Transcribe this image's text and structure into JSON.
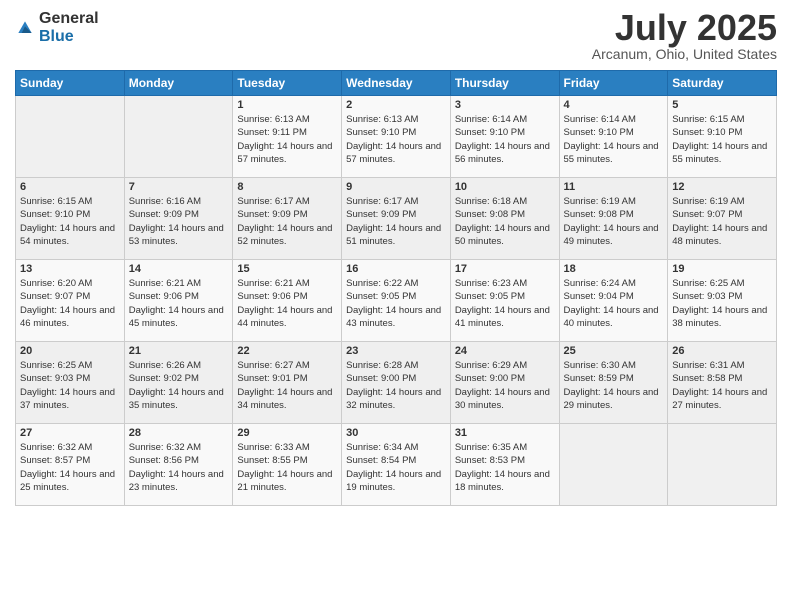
{
  "logo": {
    "general": "General",
    "blue": "Blue"
  },
  "title": "July 2025",
  "subtitle": "Arcanum, Ohio, United States",
  "weekdays": [
    "Sunday",
    "Monday",
    "Tuesday",
    "Wednesday",
    "Thursday",
    "Friday",
    "Saturday"
  ],
  "weeks": [
    [
      {
        "day": "",
        "info": ""
      },
      {
        "day": "",
        "info": ""
      },
      {
        "day": "1",
        "info": "Sunrise: 6:13 AM\nSunset: 9:11 PM\nDaylight: 14 hours and 57 minutes."
      },
      {
        "day": "2",
        "info": "Sunrise: 6:13 AM\nSunset: 9:10 PM\nDaylight: 14 hours and 57 minutes."
      },
      {
        "day": "3",
        "info": "Sunrise: 6:14 AM\nSunset: 9:10 PM\nDaylight: 14 hours and 56 minutes."
      },
      {
        "day": "4",
        "info": "Sunrise: 6:14 AM\nSunset: 9:10 PM\nDaylight: 14 hours and 55 minutes."
      },
      {
        "day": "5",
        "info": "Sunrise: 6:15 AM\nSunset: 9:10 PM\nDaylight: 14 hours and 55 minutes."
      }
    ],
    [
      {
        "day": "6",
        "info": "Sunrise: 6:15 AM\nSunset: 9:10 PM\nDaylight: 14 hours and 54 minutes."
      },
      {
        "day": "7",
        "info": "Sunrise: 6:16 AM\nSunset: 9:09 PM\nDaylight: 14 hours and 53 minutes."
      },
      {
        "day": "8",
        "info": "Sunrise: 6:17 AM\nSunset: 9:09 PM\nDaylight: 14 hours and 52 minutes."
      },
      {
        "day": "9",
        "info": "Sunrise: 6:17 AM\nSunset: 9:09 PM\nDaylight: 14 hours and 51 minutes."
      },
      {
        "day": "10",
        "info": "Sunrise: 6:18 AM\nSunset: 9:08 PM\nDaylight: 14 hours and 50 minutes."
      },
      {
        "day": "11",
        "info": "Sunrise: 6:19 AM\nSunset: 9:08 PM\nDaylight: 14 hours and 49 minutes."
      },
      {
        "day": "12",
        "info": "Sunrise: 6:19 AM\nSunset: 9:07 PM\nDaylight: 14 hours and 48 minutes."
      }
    ],
    [
      {
        "day": "13",
        "info": "Sunrise: 6:20 AM\nSunset: 9:07 PM\nDaylight: 14 hours and 46 minutes."
      },
      {
        "day": "14",
        "info": "Sunrise: 6:21 AM\nSunset: 9:06 PM\nDaylight: 14 hours and 45 minutes."
      },
      {
        "day": "15",
        "info": "Sunrise: 6:21 AM\nSunset: 9:06 PM\nDaylight: 14 hours and 44 minutes."
      },
      {
        "day": "16",
        "info": "Sunrise: 6:22 AM\nSunset: 9:05 PM\nDaylight: 14 hours and 43 minutes."
      },
      {
        "day": "17",
        "info": "Sunrise: 6:23 AM\nSunset: 9:05 PM\nDaylight: 14 hours and 41 minutes."
      },
      {
        "day": "18",
        "info": "Sunrise: 6:24 AM\nSunset: 9:04 PM\nDaylight: 14 hours and 40 minutes."
      },
      {
        "day": "19",
        "info": "Sunrise: 6:25 AM\nSunset: 9:03 PM\nDaylight: 14 hours and 38 minutes."
      }
    ],
    [
      {
        "day": "20",
        "info": "Sunrise: 6:25 AM\nSunset: 9:03 PM\nDaylight: 14 hours and 37 minutes."
      },
      {
        "day": "21",
        "info": "Sunrise: 6:26 AM\nSunset: 9:02 PM\nDaylight: 14 hours and 35 minutes."
      },
      {
        "day": "22",
        "info": "Sunrise: 6:27 AM\nSunset: 9:01 PM\nDaylight: 14 hours and 34 minutes."
      },
      {
        "day": "23",
        "info": "Sunrise: 6:28 AM\nSunset: 9:00 PM\nDaylight: 14 hours and 32 minutes."
      },
      {
        "day": "24",
        "info": "Sunrise: 6:29 AM\nSunset: 9:00 PM\nDaylight: 14 hours and 30 minutes."
      },
      {
        "day": "25",
        "info": "Sunrise: 6:30 AM\nSunset: 8:59 PM\nDaylight: 14 hours and 29 minutes."
      },
      {
        "day": "26",
        "info": "Sunrise: 6:31 AM\nSunset: 8:58 PM\nDaylight: 14 hours and 27 minutes."
      }
    ],
    [
      {
        "day": "27",
        "info": "Sunrise: 6:32 AM\nSunset: 8:57 PM\nDaylight: 14 hours and 25 minutes."
      },
      {
        "day": "28",
        "info": "Sunrise: 6:32 AM\nSunset: 8:56 PM\nDaylight: 14 hours and 23 minutes."
      },
      {
        "day": "29",
        "info": "Sunrise: 6:33 AM\nSunset: 8:55 PM\nDaylight: 14 hours and 21 minutes."
      },
      {
        "day": "30",
        "info": "Sunrise: 6:34 AM\nSunset: 8:54 PM\nDaylight: 14 hours and 19 minutes."
      },
      {
        "day": "31",
        "info": "Sunrise: 6:35 AM\nSunset: 8:53 PM\nDaylight: 14 hours and 18 minutes."
      },
      {
        "day": "",
        "info": ""
      },
      {
        "day": "",
        "info": ""
      }
    ]
  ]
}
